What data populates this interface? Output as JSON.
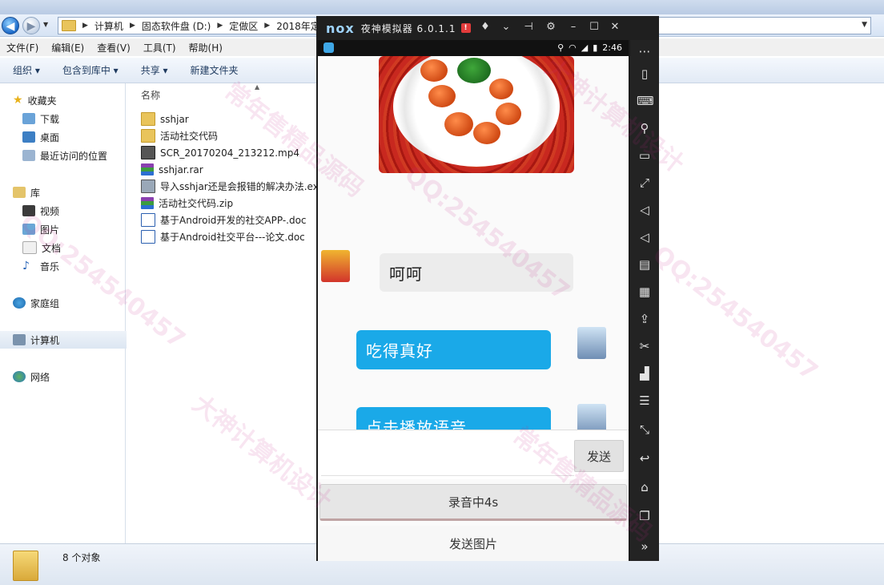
{
  "explorer": {
    "breadcrumbs": [
      "计算机",
      "固态软件盘 (D:)",
      "定做区",
      "2018年定"
    ],
    "menu": [
      "文件(F)",
      "编辑(E)",
      "查看(V)",
      "工具(T)",
      "帮助(H)"
    ],
    "toolbar": [
      "组织 ▾",
      "包含到库中 ▾",
      "共享 ▾",
      "新建文件夹"
    ],
    "nav": {
      "favorites": "收藏夹",
      "downloads": "下载",
      "desktop": "桌面",
      "recent": "最近访问的位置",
      "libraries": "库",
      "video": "视频",
      "pictures": "图片",
      "documents": "文档",
      "music": "音乐",
      "homegroup": "家庭组",
      "computer": "计算机",
      "network": "网络"
    },
    "column_name": "名称",
    "files": [
      {
        "name": "sshjar",
        "type": "folder"
      },
      {
        "name": "活动社交代码",
        "type": "folder"
      },
      {
        "name": "SCR_20170204_213212.mp4",
        "type": "video"
      },
      {
        "name": "sshjar.rar",
        "type": "archive"
      },
      {
        "name": "导入sshjar还是会报错的解决办法.exe",
        "type": "exe"
      },
      {
        "name": "活动社交代码.zip",
        "type": "archive"
      },
      {
        "name": "基于Android开发的社交APP-.doc",
        "type": "doc"
      },
      {
        "name": "基于Android社交平台---论文.doc",
        "type": "doc"
      }
    ],
    "status": "8 个对象"
  },
  "emulator": {
    "logo": "nox",
    "title": "夜神模拟器 6.0.1.1",
    "badge": "!",
    "clock": "2:46",
    "chat": {
      "left_message": "呵呵",
      "right_message_1": "吃得真好",
      "right_message_2": "点击播放语音"
    },
    "input_placeholder": "",
    "send_label": "发送",
    "record_label": "录音中4s",
    "send_photo_label": "发送图片"
  },
  "watermarks": [
    "QQ:254540457",
    "常年售精品源码",
    "大神计算机设计"
  ],
  "colors": {
    "bubble_blue": "#1aa9e8",
    "nox_dark": "#1f1f1f",
    "explorer_blue": "#dce6f2"
  }
}
